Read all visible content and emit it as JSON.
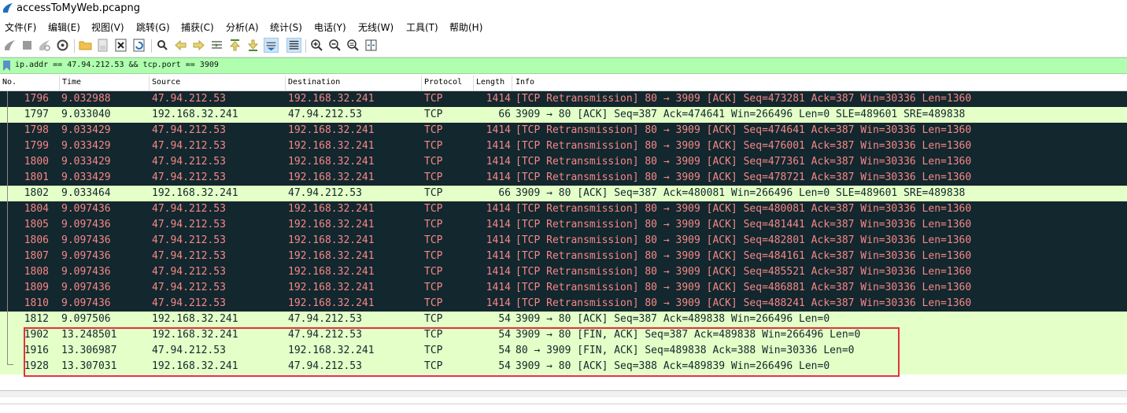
{
  "window": {
    "title": "accessToMyWeb.pcapng"
  },
  "menu": [
    "文件(F)",
    "编辑(E)",
    "视图(V)",
    "跳转(G)",
    "捕获(C)",
    "分析(A)",
    "统计(S)",
    "电话(Y)",
    "无线(W)",
    "工具(T)",
    "帮助(H)"
  ],
  "filter": {
    "value": "ip.addr == 47.94.212.53 && tcp.port == 3909"
  },
  "columns": {
    "no": "No.",
    "time": "Time",
    "source": "Source",
    "destination": "Destination",
    "protocol": "Protocol",
    "length": "Length",
    "info": "Info"
  },
  "packets": [
    {
      "no": "1796",
      "time": "9.032988",
      "src": "47.94.212.53",
      "dst": "192.168.32.241",
      "proto": "TCP",
      "len": "1414",
      "info": "[TCP Retransmission] 80 → 3909 [ACK] Seq=473281 Ack=387 Win=30336 Len=1360",
      "style": "dark"
    },
    {
      "no": "1797",
      "time": "9.033040",
      "src": "192.168.32.241",
      "dst": "47.94.212.53",
      "proto": "TCP",
      "len": "66",
      "info": "3909 → 80 [ACK] Seq=387 Ack=474641 Win=266496 Len=0 SLE=489601 SRE=489838",
      "style": "light"
    },
    {
      "no": "1798",
      "time": "9.033429",
      "src": "47.94.212.53",
      "dst": "192.168.32.241",
      "proto": "TCP",
      "len": "1414",
      "info": "[TCP Retransmission] 80 → 3909 [ACK] Seq=474641 Ack=387 Win=30336 Len=1360",
      "style": "dark"
    },
    {
      "no": "1799",
      "time": "9.033429",
      "src": "47.94.212.53",
      "dst": "192.168.32.241",
      "proto": "TCP",
      "len": "1414",
      "info": "[TCP Retransmission] 80 → 3909 [ACK] Seq=476001 Ack=387 Win=30336 Len=1360",
      "style": "dark"
    },
    {
      "no": "1800",
      "time": "9.033429",
      "src": "47.94.212.53",
      "dst": "192.168.32.241",
      "proto": "TCP",
      "len": "1414",
      "info": "[TCP Retransmission] 80 → 3909 [ACK] Seq=477361 Ack=387 Win=30336 Len=1360",
      "style": "dark"
    },
    {
      "no": "1801",
      "time": "9.033429",
      "src": "47.94.212.53",
      "dst": "192.168.32.241",
      "proto": "TCP",
      "len": "1414",
      "info": "[TCP Retransmission] 80 → 3909 [ACK] Seq=478721 Ack=387 Win=30336 Len=1360",
      "style": "dark"
    },
    {
      "no": "1802",
      "time": "9.033464",
      "src": "192.168.32.241",
      "dst": "47.94.212.53",
      "proto": "TCP",
      "len": "66",
      "info": "3909 → 80 [ACK] Seq=387 Ack=480081 Win=266496 Len=0 SLE=489601 SRE=489838",
      "style": "light"
    },
    {
      "no": "1804",
      "time": "9.097436",
      "src": "47.94.212.53",
      "dst": "192.168.32.241",
      "proto": "TCP",
      "len": "1414",
      "info": "[TCP Retransmission] 80 → 3909 [ACK] Seq=480081 Ack=387 Win=30336 Len=1360",
      "style": "dark"
    },
    {
      "no": "1805",
      "time": "9.097436",
      "src": "47.94.212.53",
      "dst": "192.168.32.241",
      "proto": "TCP",
      "len": "1414",
      "info": "[TCP Retransmission] 80 → 3909 [ACK] Seq=481441 Ack=387 Win=30336 Len=1360",
      "style": "dark"
    },
    {
      "no": "1806",
      "time": "9.097436",
      "src": "47.94.212.53",
      "dst": "192.168.32.241",
      "proto": "TCP",
      "len": "1414",
      "info": "[TCP Retransmission] 80 → 3909 [ACK] Seq=482801 Ack=387 Win=30336 Len=1360",
      "style": "dark"
    },
    {
      "no": "1807",
      "time": "9.097436",
      "src": "47.94.212.53",
      "dst": "192.168.32.241",
      "proto": "TCP",
      "len": "1414",
      "info": "[TCP Retransmission] 80 → 3909 [ACK] Seq=484161 Ack=387 Win=30336 Len=1360",
      "style": "dark"
    },
    {
      "no": "1808",
      "time": "9.097436",
      "src": "47.94.212.53",
      "dst": "192.168.32.241",
      "proto": "TCP",
      "len": "1414",
      "info": "[TCP Retransmission] 80 → 3909 [ACK] Seq=485521 Ack=387 Win=30336 Len=1360",
      "style": "dark"
    },
    {
      "no": "1809",
      "time": "9.097436",
      "src": "47.94.212.53",
      "dst": "192.168.32.241",
      "proto": "TCP",
      "len": "1414",
      "info": "[TCP Retransmission] 80 → 3909 [ACK] Seq=486881 Ack=387 Win=30336 Len=1360",
      "style": "dark"
    },
    {
      "no": "1810",
      "time": "9.097436",
      "src": "47.94.212.53",
      "dst": "192.168.32.241",
      "proto": "TCP",
      "len": "1414",
      "info": "[TCP Retransmission] 80 → 3909 [ACK] Seq=488241 Ack=387 Win=30336 Len=1360",
      "style": "dark"
    },
    {
      "no": "1812",
      "time": "9.097506",
      "src": "192.168.32.241",
      "dst": "47.94.212.53",
      "proto": "TCP",
      "len": "54",
      "info": "3909 → 80 [ACK] Seq=387 Ack=489838 Win=266496 Len=0",
      "style": "light"
    },
    {
      "no": "1902",
      "time": "13.248501",
      "src": "192.168.32.241",
      "dst": "47.94.212.53",
      "proto": "TCP",
      "len": "54",
      "info": "3909 → 80 [FIN, ACK] Seq=387 Ack=489838 Win=266496 Len=0",
      "style": "light"
    },
    {
      "no": "1916",
      "time": "13.306987",
      "src": "47.94.212.53",
      "dst": "192.168.32.241",
      "proto": "TCP",
      "len": "54",
      "info": "80 → 3909 [FIN, ACK] Seq=489838 Ack=388 Win=30336 Len=0",
      "style": "light"
    },
    {
      "no": "1928",
      "time": "13.307031",
      "src": "192.168.32.241",
      "dst": "47.94.212.53",
      "proto": "TCP",
      "len": "54",
      "info": "3909 → 80 [ACK] Seq=388 Ack=489839 Win=266496 Len=0",
      "style": "light"
    }
  ],
  "colors": {
    "dark_row_bg": "#12272e",
    "dark_row_fg": "#f78787",
    "light_row_bg": "#e4ffc7",
    "filter_bg": "#afffaf",
    "highlight": "#e0333a"
  }
}
